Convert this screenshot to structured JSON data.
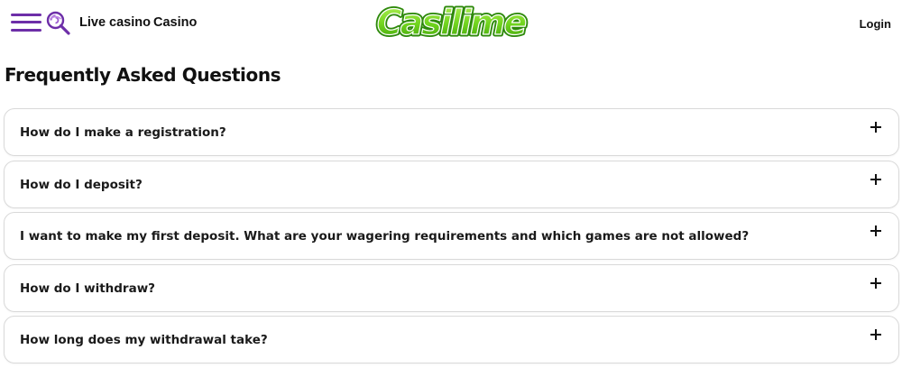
{
  "header": {
    "menu_icon": "hamburger-menu-icon",
    "search_icon": "lollipop-search-icon",
    "nav": [
      {
        "label": "Live casino"
      },
      {
        "label": "Casino"
      }
    ],
    "logo_text": "Casilime",
    "login_label": "Login"
  },
  "faq": {
    "title": "Frequently Asked Questions",
    "expand_icon": "plus-icon",
    "items": [
      {
        "question": "How do I make a registration?"
      },
      {
        "question": "How do I deposit?"
      },
      {
        "question": "I want to make my first deposit. What are your wagering requirements and which games are not allowed?"
      },
      {
        "question": "How do I withdraw?"
      },
      {
        "question": "How long does my withdrawal take?"
      }
    ]
  },
  "colors": {
    "brand_purple": "#6d2ea8",
    "logo_green": "#6fd31c",
    "logo_green_dark": "#2e8a0b",
    "text": "#111111",
    "border": "#d9d9d9"
  }
}
